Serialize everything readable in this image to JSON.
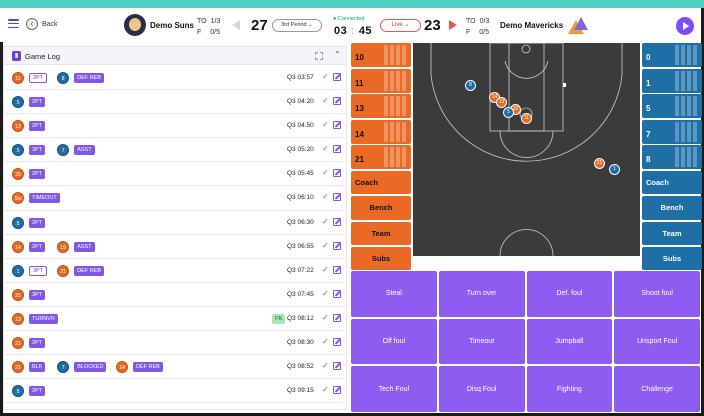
{
  "header": {
    "back_label": "Back",
    "home": {
      "name": "Demo Suns",
      "score": "27",
      "to": "1/3",
      "fouls": "0/5"
    },
    "away": {
      "name": "Demo Mavericks",
      "score": "23",
      "to": "0/3",
      "fouls": "0/5"
    },
    "to_label": "TO",
    "f_label": "F",
    "period": "3rd Period",
    "connection": "Connected",
    "clock_min": "03",
    "clock_sec": "45",
    "live_label": "Live",
    "colors": {
      "accent": "#7c4dff",
      "home": "#ea6a25",
      "away": "#1d6fa5",
      "teal": "#4fd1c5"
    }
  },
  "game_log": {
    "title": "Game Log",
    "rows": [
      {
        "p1": "11",
        "t1": "2PT",
        "t1_style": "outline",
        "p2": "8",
        "p2_team": "away",
        "t2": "DEF REB",
        "time": "Q3 03:57",
        "p1_team": "home"
      },
      {
        "p1": "5",
        "p1_team": "away",
        "t1": "2PT",
        "time": "Q3 04:20"
      },
      {
        "p1": "13",
        "p1_team": "home",
        "t1": "2PT",
        "time": "Q3 04:50"
      },
      {
        "p1": "5",
        "p1_team": "away",
        "t1": "3PT",
        "p2": "7",
        "p2_team": "away",
        "t2": "ASST",
        "time": "Q3 05:20"
      },
      {
        "p1": "20",
        "p1_team": "home",
        "t1": "2PT",
        "time": "Q3 05:45"
      },
      {
        "p1": "Sw",
        "p1_team": "home",
        "t1": "TIMEOUT",
        "time": "Q3 06:10"
      },
      {
        "p1": "5",
        "p1_team": "away",
        "t1": "2PT",
        "time": "Q3 06:30"
      },
      {
        "p1": "14",
        "p1_team": "home",
        "t1": "2PT",
        "p2": "19",
        "p2_team": "home",
        "t2": "ASST",
        "time": "Q3 06:55"
      },
      {
        "p1": "1",
        "p1_team": "away",
        "t1": "3PT",
        "t1_style": "outline",
        "p2": "21",
        "p2_team": "home",
        "t2": "DEF REB",
        "time": "Q3 07:22"
      },
      {
        "p1": "25",
        "p1_team": "home",
        "t1": "3PT",
        "time": "Q3 07:45"
      },
      {
        "p1": "13",
        "p1_team": "home",
        "t1": "TURNVR",
        "fb": "FB",
        "time": "Q3 08:12"
      },
      {
        "p1": "21",
        "p1_team": "home",
        "t1": "2PT",
        "time": "Q3 08:30"
      },
      {
        "p1": "21",
        "p1_team": "home",
        "t1": "BLK",
        "p2": "7",
        "p2_team": "away",
        "t2": "BLOCKED",
        "p3": "14",
        "p3_team": "home",
        "t3": "DEF REB",
        "time": "Q3 08:52"
      },
      {
        "p1": "5",
        "p1_team": "away",
        "t1": "2PT",
        "time": "Q3 09:15"
      }
    ]
  },
  "home_panel": {
    "players": [
      "10",
      "11",
      "13",
      "14",
      "21"
    ],
    "coach": "Coach",
    "bench": "Bench",
    "team": "Team",
    "subs": "Subs"
  },
  "away_panel": {
    "players": [
      "0",
      "1",
      "5",
      "7",
      "8"
    ],
    "coach": "Coach",
    "bench": "Bench",
    "team": "Team",
    "subs": "Subs"
  },
  "court_markers": [
    {
      "label": "8",
      "team": "away"
    },
    {
      "label": "14",
      "team": "home"
    },
    {
      "label": "13",
      "team": "home"
    },
    {
      "label": "10",
      "team": "home"
    },
    {
      "label": "5",
      "team": "away"
    },
    {
      "label": "11",
      "team": "home"
    },
    {
      "label": "21",
      "team": "home"
    },
    {
      "label": "1",
      "team": "away"
    }
  ],
  "actions": [
    "Steal",
    "Turn over",
    "Def. foul",
    "Shoot foul",
    "Off foul",
    "Timeout",
    "Jumpball",
    "Unsport Foul",
    "Tech Foul",
    "Disq Foul",
    "Fighting",
    "Challenge"
  ]
}
